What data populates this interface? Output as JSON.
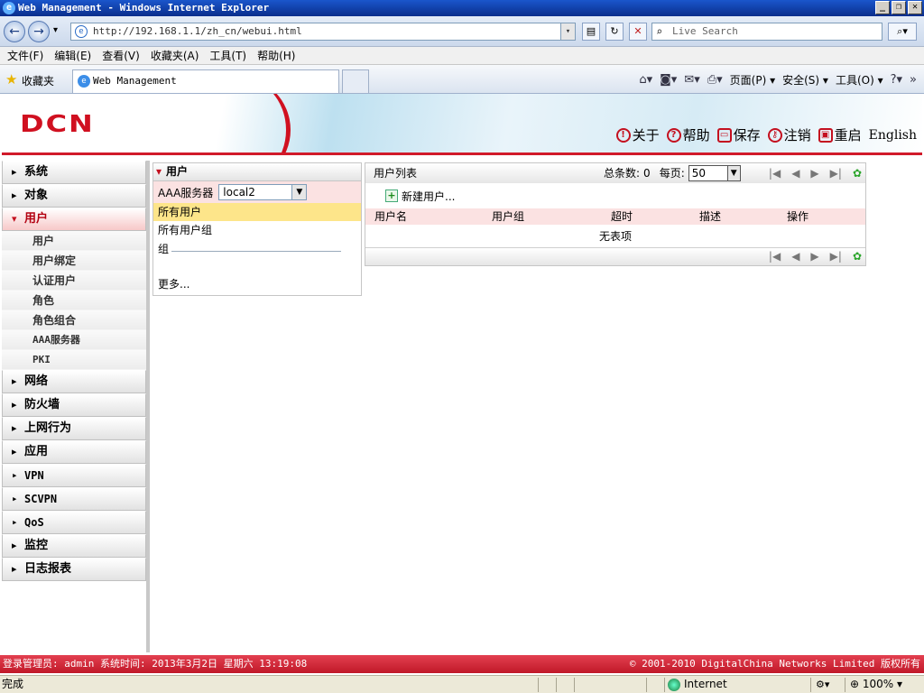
{
  "window": {
    "title": "Web Management - Windows Internet Explorer",
    "url": "http://192.168.1.1/zh_cn/webui.html",
    "search_placeholder": "Live Search"
  },
  "menubar": [
    "文件(F)",
    "编辑(E)",
    "查看(V)",
    "收藏夹(A)",
    "工具(T)",
    "帮助(H)"
  ],
  "favbar": {
    "favorites": "收藏夹",
    "tab_title": "Web Management",
    "commands": [
      "页面(P)",
      "安全(S)",
      "工具(O)"
    ]
  },
  "header": {
    "logo": "DCN",
    "links": [
      {
        "label": "关于",
        "icon": "info-icon"
      },
      {
        "label": "帮助",
        "icon": "help-icon"
      },
      {
        "label": "保存",
        "icon": "save-icon"
      },
      {
        "label": "注销",
        "icon": "logout-key-icon"
      },
      {
        "label": "重启",
        "icon": "restart-icon"
      }
    ],
    "language": "English"
  },
  "sidebar": {
    "top": [
      {
        "label": "系统"
      },
      {
        "label": "对象"
      },
      {
        "label": "用户"
      }
    ],
    "user_sub": [
      "用户",
      "用户绑定",
      "认证用户",
      "角色",
      "角色组合",
      "AAA服务器",
      "PKI"
    ],
    "rest": [
      "网络",
      "防火墙",
      "上网行为",
      "应用",
      "VPN",
      "SCVPN",
      "QoS",
      "监控",
      "日志报表"
    ]
  },
  "user_panel": {
    "title": "用户",
    "aaa_label": "AAA服务器",
    "aaa_value": "local2",
    "items": [
      "所有用户",
      "所有用户组"
    ],
    "group_label": "组",
    "more": "更多..."
  },
  "user_list": {
    "title": "用户列表",
    "total_label": "总条数:",
    "total_count": "0",
    "per_page_label": "每页:",
    "per_page_value": "50",
    "new_user": "新建用户...",
    "columns": [
      "用户名",
      "用户组",
      "超时",
      "描述",
      "操作"
    ],
    "empty": "无表项"
  },
  "info_bar": {
    "left": "登录管理员: admin 系统时间: 2013年3月2日 星期六 13:19:08",
    "right": "© 2001-2010 DigitalChina Networks Limited 版权所有"
  },
  "statusbar": {
    "status": "完成",
    "zone": "Internet",
    "zoom": "100%"
  }
}
